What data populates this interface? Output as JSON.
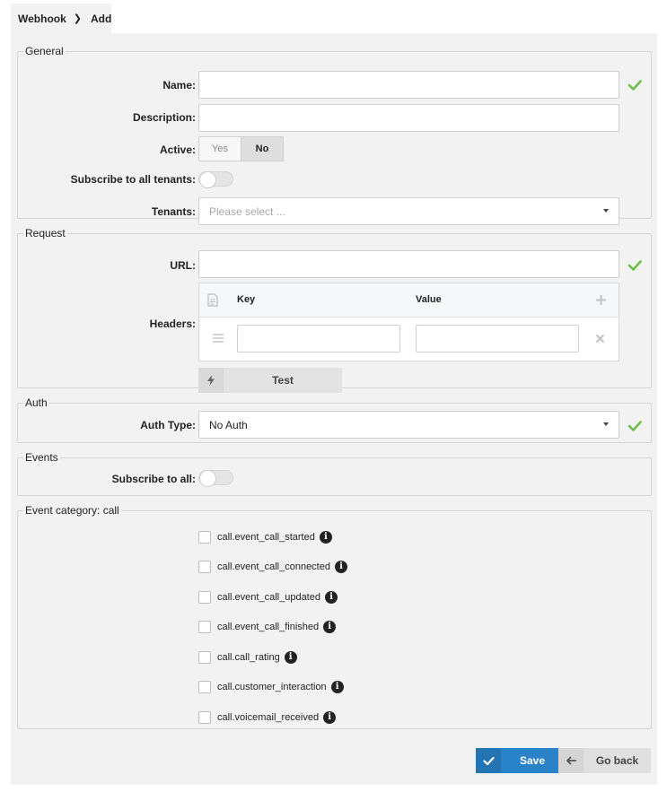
{
  "breadcrumb": {
    "parent": "Webhook",
    "current": "Add"
  },
  "general": {
    "legend": "General",
    "name_label": "Name:",
    "name_value": "",
    "description_label": "Description:",
    "description_value": "",
    "active_label": "Active:",
    "active_yes": "Yes",
    "active_no": "No",
    "active_selected": "No",
    "subscribe_tenants_label": "Subscribe to all tenants:",
    "subscribe_tenants_on": false,
    "tenants_label": "Tenants:",
    "tenants_placeholder": "Please select ..."
  },
  "request": {
    "legend": "Request",
    "url_label": "URL:",
    "url_value": "",
    "headers_label": "Headers:",
    "key_header": "Key",
    "value_header": "Value",
    "test_label": "Test"
  },
  "auth": {
    "legend": "Auth",
    "auth_type_label": "Auth Type:",
    "auth_type_value": "No Auth"
  },
  "events": {
    "legend": "Events",
    "subscribe_all_label": "Subscribe to all:",
    "subscribe_all_on": false
  },
  "event_category": {
    "legend": "Event category: call",
    "items": [
      "call.event_call_started",
      "call.event_call_connected",
      "call.event_call_updated",
      "call.event_call_finished",
      "call.call_rating",
      "call.customer_interaction",
      "call.voicemail_received"
    ]
  },
  "actions": {
    "save": "Save",
    "go_back": "Go back"
  },
  "colors": {
    "valid_check": "#6cc04a",
    "primary": "#2a82c8"
  }
}
